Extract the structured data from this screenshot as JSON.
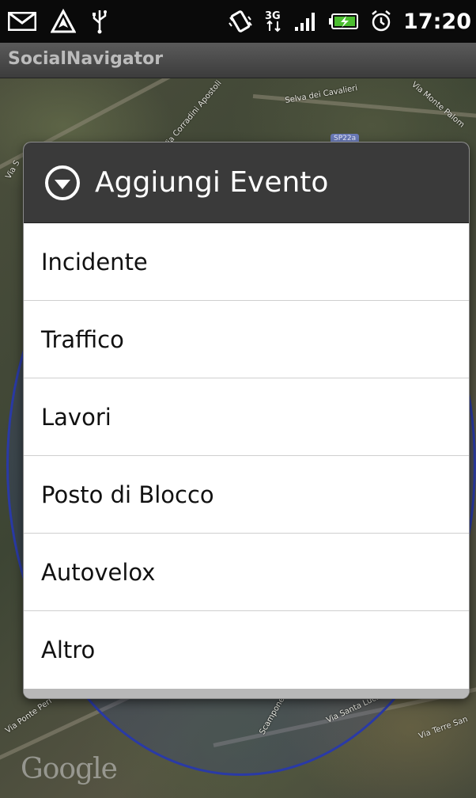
{
  "status_bar": {
    "time": "17:20",
    "network": "3G",
    "icons": [
      "mail-icon",
      "navigation-warning-icon",
      "usb-icon",
      "vibrate-icon",
      "3g-data-icon",
      "signal-icon",
      "battery-charging-icon",
      "alarm-icon"
    ]
  },
  "app": {
    "title": "SocialNavigator"
  },
  "map": {
    "labels": [
      "Via Monte Palom",
      "Via Corradini Apostoli",
      "Selva dei Cavalieri",
      "Via S",
      "SP22a",
      "Via Terre San",
      "Via Santa Lucia",
      "Scampone",
      "Via Ponte Peri",
      "Google"
    ]
  },
  "dialog": {
    "title": "Aggiungi Evento",
    "items": [
      "Incidente",
      "Traffico",
      "Lavori",
      "Posto di Blocco",
      "Autovelox",
      "Altro"
    ]
  },
  "colors": {
    "dialog_header": "#3a3a3a",
    "radius_circle": "#2a3aa6"
  }
}
